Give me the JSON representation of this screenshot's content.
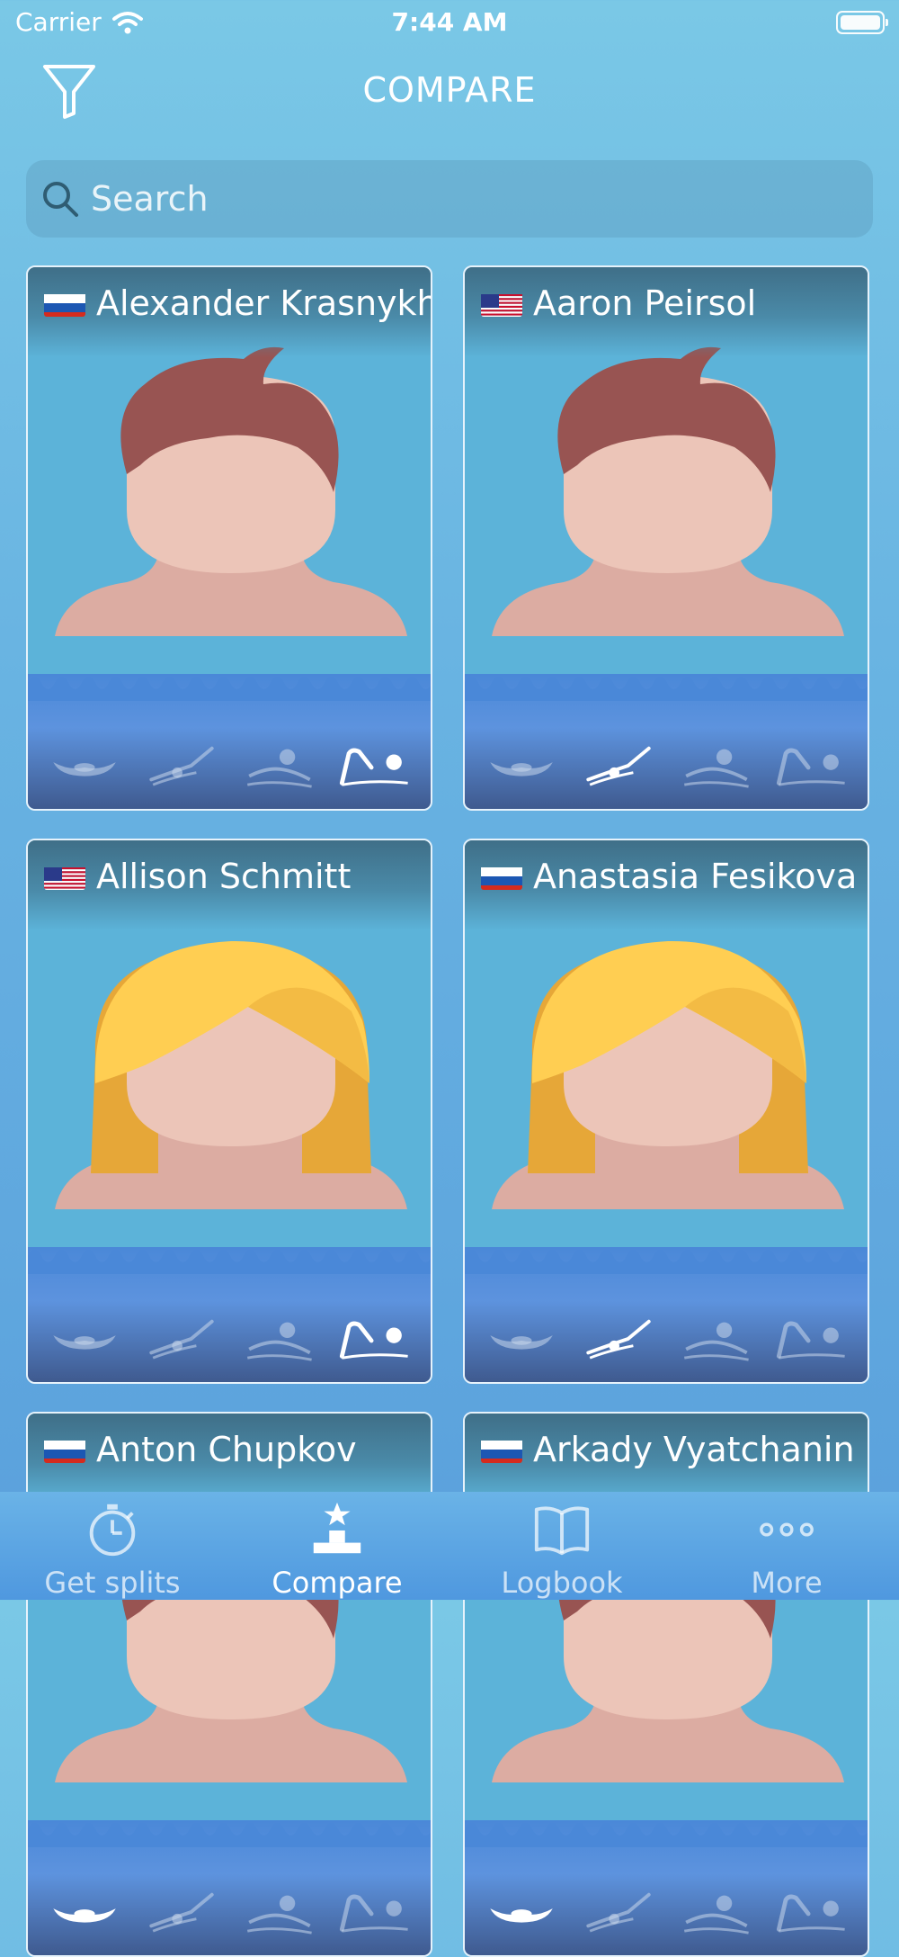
{
  "status_bar": {
    "carrier": "Carrier",
    "time": "7:44 AM"
  },
  "header": {
    "title": "COMPARE"
  },
  "search": {
    "placeholder": "Search"
  },
  "athletes": [
    {
      "name": "Alexander Krasnykh",
      "country": "Russia",
      "gender": "male",
      "active_stroke": 3
    },
    {
      "name": "Aaron Peirsol",
      "country": "USA",
      "gender": "male",
      "active_stroke": 1
    },
    {
      "name": "Allison Schmitt",
      "country": "USA",
      "gender": "female",
      "active_stroke": 3
    },
    {
      "name": "Anastasia Fesikova",
      "country": "Russia",
      "gender": "female",
      "active_stroke": 1
    },
    {
      "name": "Anton Chupkov",
      "country": "Russia",
      "gender": "male",
      "active_stroke": 0
    },
    {
      "name": "Arkady Vyatchanin",
      "country": "Russia",
      "gender": "male",
      "active_stroke": 0
    }
  ],
  "strokes": [
    "butterfly-icon",
    "backstroke-icon",
    "breaststroke-icon",
    "freestyle-icon"
  ],
  "tabbar": {
    "tabs": [
      {
        "label": "Get splits",
        "icon": "stopwatch-icon"
      },
      {
        "label": "Compare",
        "icon": "podium-icon"
      },
      {
        "label": "Logbook",
        "icon": "book-icon"
      },
      {
        "label": "More",
        "icon": "more-icon"
      }
    ],
    "active": "Compare"
  },
  "colors": {
    "background_top": "#7ac8e6",
    "background_bottom": "#5aa0dc",
    "card_bg": "#5cb3d9",
    "skin": "#ecc5b8",
    "hair_male": "#985452",
    "hair_female": "#ffce52"
  }
}
